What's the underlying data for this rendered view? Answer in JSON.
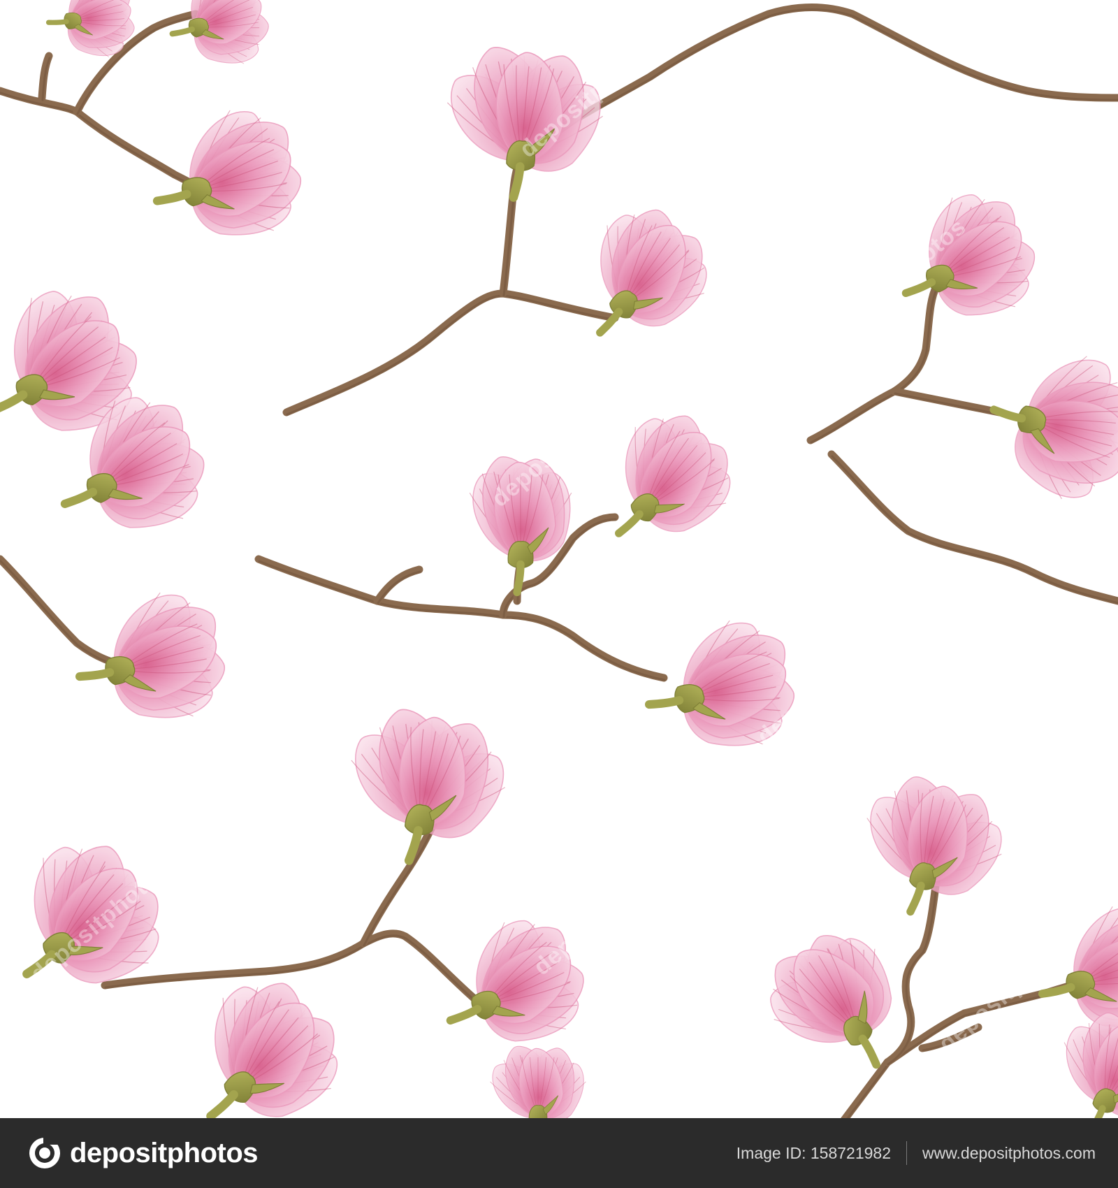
{
  "artwork": {
    "subject": "watermark-magnolia-pattern",
    "colors": {
      "background": "#ffffff",
      "petal_light": "#f7cfe0",
      "petal_mid": "#eb9bbd",
      "petal_dark": "#d9638f",
      "petal_vein": "#c94f78",
      "sepal": "#a3a44e",
      "sepal_dark": "#7d7e35",
      "branch": "#8a6a4e",
      "branch_dark": "#6f5239"
    },
    "watermark_text": "depositphotos"
  },
  "footer": {
    "logo_text": "depositphotos",
    "image_id_label": "Image ID: 158721982",
    "site_url": "www.depositphotos.com",
    "background": "#2b2b2b"
  }
}
